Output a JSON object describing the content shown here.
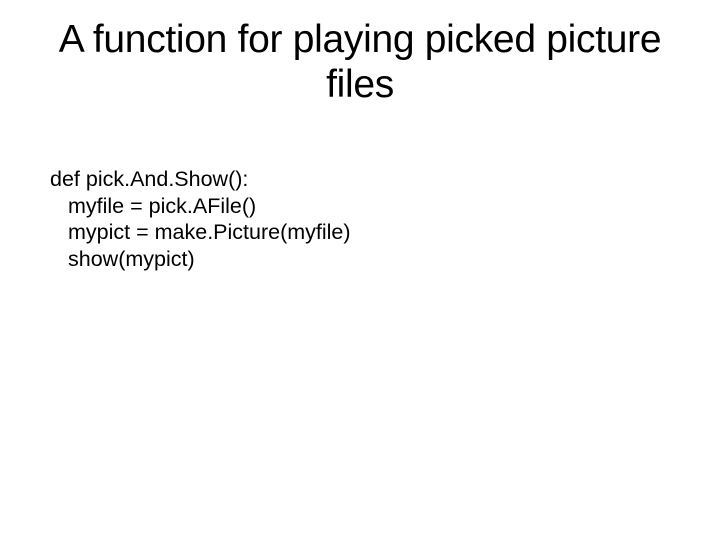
{
  "slide": {
    "title": "A function for playing picked picture files",
    "code": {
      "line1": "def pick.And.Show():",
      "line2": "myfile = pick.AFile()",
      "line3": "mypict = make.Picture(myfile)",
      "line4": "show(mypict)"
    }
  }
}
